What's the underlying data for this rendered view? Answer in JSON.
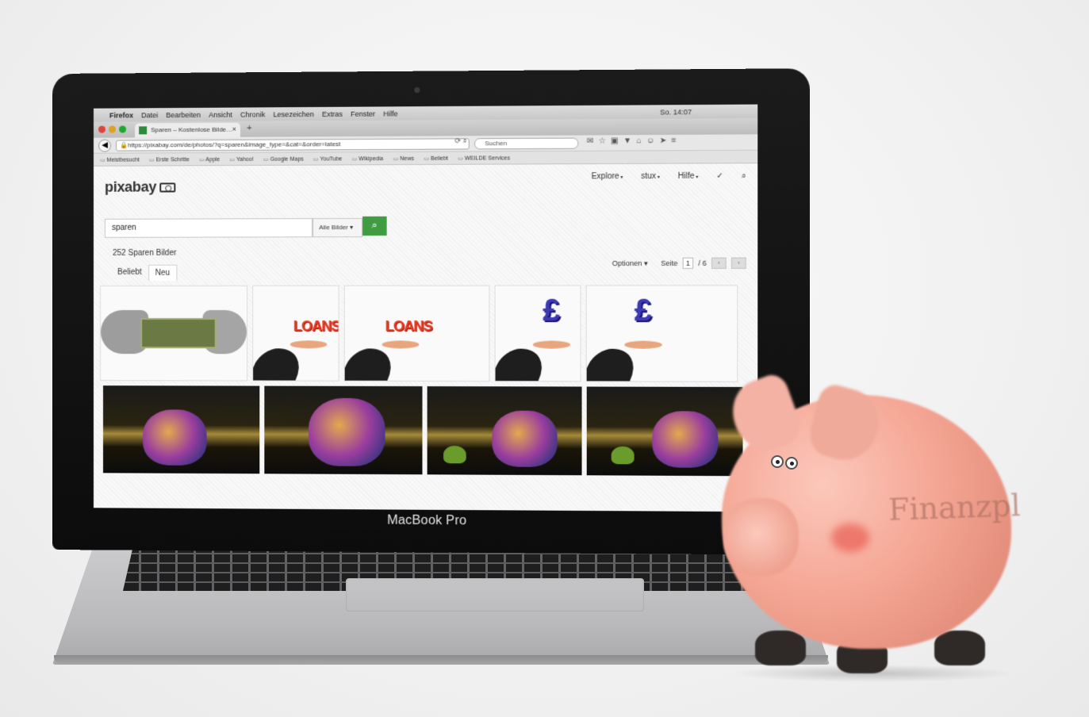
{
  "laptop": {
    "brand_label": "MacBook Pro"
  },
  "menubar": {
    "items": [
      "Firefox",
      "Datei",
      "Bearbeiten",
      "Ansicht",
      "Chronik",
      "Lesezeichen",
      "Extras",
      "Fenster",
      "Hilfe"
    ],
    "clock": "So. 14:07"
  },
  "browser": {
    "tab_title": "Sparen – Kostenlose Bilde…",
    "url": "https://pixabay.com/de/photos/?q=sparen&image_type=&cat=&order=latest",
    "search_placeholder": "Suchen",
    "bookmarks": [
      "Meistbesucht",
      "Erste Schritte",
      "Apple",
      "Yahoo!",
      "Google Maps",
      "YouTube",
      "Wikipedia",
      "News",
      "Beliebt",
      "WEILDE Services"
    ]
  },
  "page": {
    "logo": "pixabay",
    "nav": [
      "Explore",
      "stux",
      "Hilfe"
    ],
    "search_value": "sparen",
    "filter_select": "Alle Bilder",
    "result_count": "252 Sparen Bilder",
    "options_label": "Optionen",
    "page_label": "Seite",
    "page_current": "1",
    "page_total": "/ 6",
    "tabs": [
      "Beliebt",
      "Neu"
    ],
    "thumb_text_loans": "LOANS",
    "thumb_text_pound": "£"
  },
  "piggy": {
    "text": "Finanzpl"
  }
}
